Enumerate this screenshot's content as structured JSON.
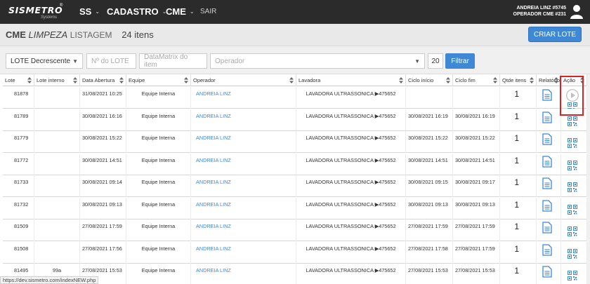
{
  "brand": {
    "name": "SISMETRO",
    "reg": "®",
    "sub": "Systems"
  },
  "nav": [
    {
      "label": "SS",
      "caret": "⌄"
    },
    {
      "label": "CADASTRO",
      "caret": "⌄"
    },
    {
      "label": "CME",
      "caret": "⌄"
    }
  ],
  "nav_sair": "SAIR",
  "user": {
    "line1": "ANDREIA LINZ #5745",
    "line2": "OPERADOR CME #231"
  },
  "header": {
    "title_bold": "CME",
    "title_italic": "LIMPEZA",
    "title_sub": "LISTAGEM",
    "count": "24 itens",
    "create_label": "CRIAR LOTE"
  },
  "filters": {
    "order_value": "LOTE Decrescente",
    "lote_placeholder": "Nº do LOTE",
    "datamatrix_placeholder": "DataMatrix do item",
    "operador_placeholder": "Operador",
    "page_size": "20",
    "filter_label": "Filtrar"
  },
  "columns": [
    "Lote",
    "Lote interno",
    "Data Abertura",
    "Equipe",
    "Operador",
    "Lavadora",
    "Ciclo início",
    "Ciclo fim",
    "Qtde itens",
    "Relatório",
    "Ação"
  ],
  "rows": [
    {
      "lote": "81878",
      "lote_interno": "",
      "abertura": "31/08/2021 10:25",
      "equipe": "Equipe Interna",
      "operador": "ANDREIA LINZ",
      "lavadora": "LAVADORA ULTRASSONICA ▶475652",
      "ciclo_inicio": "",
      "ciclo_fim": "",
      "qtde": "1",
      "play": true
    },
    {
      "lote": "81789",
      "lote_interno": "",
      "abertura": "30/08/2021 16:16",
      "equipe": "Equipe Interna",
      "operador": "ANDREIA LINZ",
      "lavadora": "LAVADORA ULTRASSONICA ▶475652",
      "ciclo_inicio": "30/08/2021 16:19",
      "ciclo_fim": "30/08/2021 16:19",
      "qtde": "1",
      "play": false
    },
    {
      "lote": "81779",
      "lote_interno": "",
      "abertura": "30/08/2021 15:22",
      "equipe": "Equipe Interna",
      "operador": "ANDREIA LINZ",
      "lavadora": "LAVADORA ULTRASSONICA ▶475652",
      "ciclo_inicio": "30/08/2021 15:22",
      "ciclo_fim": "30/08/2021 15:22",
      "qtde": "1",
      "play": false
    },
    {
      "lote": "81772",
      "lote_interno": "",
      "abertura": "30/08/2021 14:51",
      "equipe": "Equipe Interna",
      "operador": "ANDREIA LINZ",
      "lavadora": "LAVADORA ULTRASSONICA ▶475652",
      "ciclo_inicio": "30/08/2021 14:51",
      "ciclo_fim": "30/08/2021 14:51",
      "qtde": "1",
      "play": false
    },
    {
      "lote": "81733",
      "lote_interno": "",
      "abertura": "30/08/2021 09:14",
      "equipe": "Equipe Interna",
      "operador": "ANDREIA LINZ",
      "lavadora": "LAVADORA ULTRASSONICA ▶475652",
      "ciclo_inicio": "30/08/2021 09:15",
      "ciclo_fim": "30/08/2021 09:17",
      "qtde": "1",
      "play": false
    },
    {
      "lote": "81732",
      "lote_interno": "",
      "abertura": "30/08/2021 09:13",
      "equipe": "Equipe Interna",
      "operador": "ANDREIA LINZ",
      "lavadora": "LAVADORA ULTRASSONICA ▶475652",
      "ciclo_inicio": "30/08/2021 09:13",
      "ciclo_fim": "30/08/2021 09:13",
      "qtde": "1",
      "play": false
    },
    {
      "lote": "81509",
      "lote_interno": "",
      "abertura": "27/08/2021 17:59",
      "equipe": "Equipe Interna",
      "operador": "ANDREIA LINZ",
      "lavadora": "LAVADORA ULTRASSONICA ▶475652",
      "ciclo_inicio": "27/08/2021 17:59",
      "ciclo_fim": "27/08/2021 17:59",
      "qtde": "1",
      "play": false
    },
    {
      "lote": "81508",
      "lote_interno": "",
      "abertura": "27/08/2021 17:56",
      "equipe": "Equipe Interna",
      "operador": "ANDREIA LINZ",
      "lavadora": "LAVADORA ULTRASSONICA ▶475652",
      "ciclo_inicio": "27/08/2021 17:58",
      "ciclo_fim": "27/08/2021 17:59",
      "qtde": "1",
      "play": false
    },
    {
      "lote": "81495",
      "lote_interno": "99a",
      "abertura": "27/08/2021 15:53",
      "equipe": "Equipe Interna",
      "operador": "ANDREIA LINZ",
      "lavadora": "LAVADORA ULTRASSONICA ▶475652",
      "ciclo_inicio": "27/08/2021 15:53",
      "ciclo_fim": "27/08/2021 15:53",
      "qtde": "1",
      "play": false
    }
  ],
  "status_url": "https://dev.sismetro.com/indexNEW.php",
  "icons": {
    "report": "document-icon",
    "qr": "qrcode-icon",
    "play": "play-circle-icon",
    "user": "user-icon",
    "sort": "sort-icon"
  },
  "colors": {
    "accent": "#3f88d6",
    "topbar": "#2b2b2b",
    "highlight": "#e02020"
  }
}
